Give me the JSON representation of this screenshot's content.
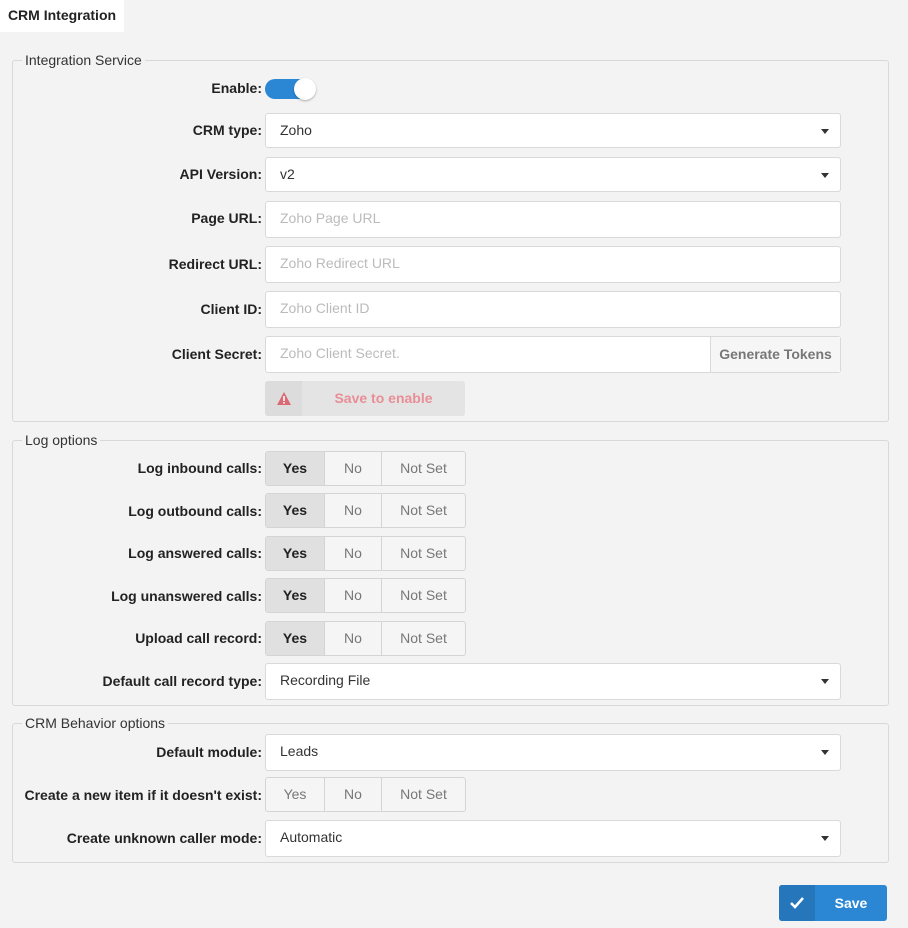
{
  "tab": {
    "label": "CRM Integration"
  },
  "integration": {
    "legend": "Integration Service",
    "enable_label": "Enable:",
    "enable_on": true,
    "crm_type": {
      "label": "CRM type:",
      "value": "Zoho"
    },
    "api_version": {
      "label": "API Version:",
      "value": "v2"
    },
    "page_url": {
      "label": "Page URL:",
      "placeholder": "Zoho Page URL"
    },
    "redirect_url": {
      "label": "Redirect URL:",
      "placeholder": "Zoho Redirect URL"
    },
    "client_id": {
      "label": "Client ID:",
      "placeholder": "Zoho Client ID"
    },
    "client_secret": {
      "label": "Client Secret:",
      "placeholder": "Zoho Client Secret.",
      "button": "Generate Tokens"
    },
    "save_to_enable": "Save to enable"
  },
  "log": {
    "legend": "Log options",
    "options": {
      "yes": "Yes",
      "no": "No",
      "not_set": "Not Set"
    },
    "rows": [
      {
        "label": "Log inbound calls:",
        "selected": "Yes"
      },
      {
        "label": "Log outbound calls:",
        "selected": "Yes"
      },
      {
        "label": "Log answered calls:",
        "selected": "Yes"
      },
      {
        "label": "Log unanswered calls:",
        "selected": "Yes"
      },
      {
        "label": "Upload call record:",
        "selected": "Yes"
      }
    ],
    "record_type": {
      "label": "Default call record type:",
      "value": "Recording File"
    }
  },
  "behavior": {
    "legend": "CRM Behavior options",
    "default_module": {
      "label": "Default module:",
      "value": "Leads"
    },
    "create_item": {
      "label": "Create a new item if it doesn't exist:",
      "selected": ""
    },
    "unknown_mode": {
      "label": "Create unknown caller mode:",
      "value": "Automatic"
    }
  },
  "save_label": "Save",
  "colors": {
    "accent": "#2b87d4",
    "warning_text": "#e98e97"
  }
}
